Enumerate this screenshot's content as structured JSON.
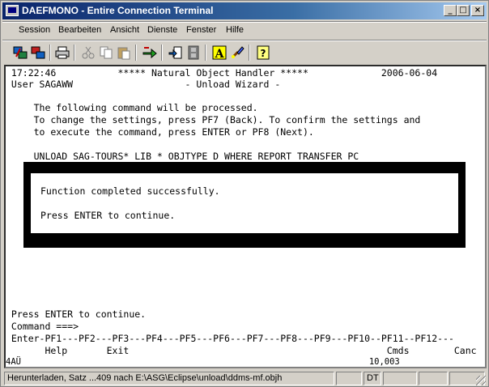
{
  "window": {
    "title": "DAEFMONO - Entire Connection Terminal",
    "min_symbol": "_",
    "max_symbol": "□",
    "close_symbol": "×"
  },
  "menu": [
    "Session",
    "Bearbeiten",
    "Ansicht",
    "Dienste",
    "Fenster",
    "Hilfe"
  ],
  "toolbar_icons": [
    "connect-icon",
    "disconnect-icon",
    "print-icon",
    "cut-icon",
    "copy-icon",
    "paste-icon",
    "transfer-icon",
    "download-icon",
    "film-icon",
    "font-icon",
    "brush-icon",
    "help-icon"
  ],
  "terminal": {
    "lines": [
      " 17:22:46           ***** Natural Object Handler *****             2006-06-04",
      " User SAGAWW                    - Unload Wizard -",
      "",
      "     The following command will be processed.",
      "     To change the settings, press PF7 (Back). To confirm the settings and",
      "     to execute the command, press ENTER or PF8 (Next).",
      "",
      "     UNLOAD SAG-TOURS* LIB * OBJTYPE D WHERE REPORT TRANSFER PC"
    ],
    "popup_lines": [
      "Function completed successfully.",
      "",
      "Press ENTER to continue."
    ],
    "bottom_lines": [
      " Press ENTER to continue.",
      " Command ===>",
      " Enter-PF1---PF2---PF3---PF4---PF5---PF6---PF7---PF8---PF9---PF10--PF11--PF12---",
      "       Help       Exit                                              Cmds        Canc",
      "4AÜ                                                                    10,003"
    ]
  },
  "statusbar": {
    "message": "Herunterladen, Satz ...409  nach E:\\ASG\\Eclipse\\unload\\ddms-mf.objh",
    "mode": "DT"
  }
}
